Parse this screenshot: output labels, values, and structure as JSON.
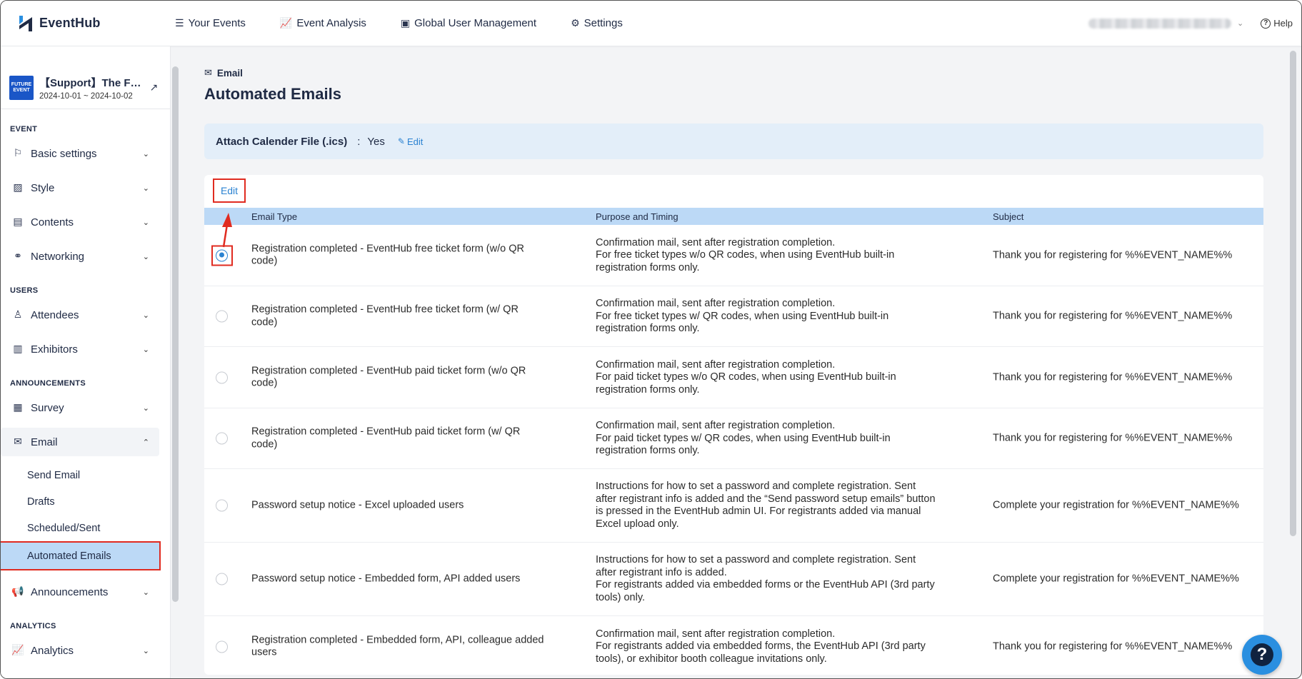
{
  "app": {
    "name": "EventHub"
  },
  "nav": {
    "items": [
      {
        "label": "Your Events",
        "icon": "list-icon"
      },
      {
        "label": "Event Analysis",
        "icon": "chart-icon"
      },
      {
        "label": "Global User Management",
        "icon": "id-card-icon"
      },
      {
        "label": "Settings",
        "icon": "gear-icon"
      }
    ],
    "help_label": "Help"
  },
  "event": {
    "thumb_text": "FUTURE EVENT",
    "name": "【Support】The F…",
    "dates": "2024-10-01 ~ 2024-10-02"
  },
  "sidebar": {
    "sections": {
      "event": "EVENT",
      "users": "USERS",
      "announcements": "ANNOUNCEMENTS",
      "analytics": "ANALYTICS"
    },
    "items": {
      "basic_settings": "Basic settings",
      "style": "Style",
      "contents": "Contents",
      "networking": "Networking",
      "attendees": "Attendees",
      "exhibitors": "Exhibitors",
      "survey": "Survey",
      "email": "Email",
      "announcements": "Announcements",
      "analytics": "Analytics"
    },
    "email_sub": {
      "send_email": "Send Email",
      "drafts": "Drafts",
      "scheduled_sent": "Scheduled/Sent",
      "automated_emails": "Automated Emails"
    }
  },
  "main": {
    "breadcrumb": "Email",
    "title": "Automated Emails",
    "ics": {
      "label": "Attach Calender File (.ics)",
      "sep": ":",
      "value": "Yes",
      "edit": "Edit"
    },
    "edit_button": "Edit",
    "table": {
      "headers": {
        "type": "Email Type",
        "purpose": "Purpose and Timing",
        "subject": "Subject"
      },
      "rows": [
        {
          "type1": "Registration completed - EventHub free ticket form (w/o QR",
          "type2": "code)",
          "p1": "Confirmation mail, sent after registration completion.",
          "p2": "For free ticket types w/o QR codes, when using EventHub built-in",
          "p3": "registration forms only.",
          "subject": "Thank you for registering for %%EVENT_NAME%%",
          "selected": true
        },
        {
          "type1": "Registration completed - EventHub free ticket form (w/ QR",
          "type2": "code)",
          "p1": "Confirmation mail, sent after registration completion.",
          "p2": "For free ticket types w/ QR codes, when using EventHub built-in",
          "p3": "registration forms only.",
          "subject": "Thank you for registering for %%EVENT_NAME%%",
          "selected": false
        },
        {
          "type1": "Registration completed - EventHub paid ticket form (w/o QR",
          "type2": "code)",
          "p1": "Confirmation mail, sent after registration completion.",
          "p2": "For paid ticket types w/o QR codes, when using EventHub built-in",
          "p3": "registration forms only.",
          "subject": "Thank you for registering for %%EVENT_NAME%%",
          "selected": false
        },
        {
          "type1": "Registration completed - EventHub paid ticket form (w/ QR",
          "type2": "code)",
          "p1": "Confirmation mail, sent after registration completion.",
          "p2": "For paid ticket types w/ QR codes, when using EventHub built-in",
          "p3": "registration forms only.",
          "subject": "Thank you for registering for %%EVENT_NAME%%",
          "selected": false
        },
        {
          "type1": "Password setup notice - Excel uploaded users",
          "type2": "",
          "p1": "Instructions for how to set a password and complete registration. Sent",
          "p2": "after registrant info is added and the “Send password setup emails” button",
          "p3": "is pressed in the EventHub admin UI. For registrants added via manual",
          "p4": "Excel upload only.",
          "subject": "Complete your registration for %%EVENT_NAME%%",
          "selected": false
        },
        {
          "type1": "Password setup notice - Embedded form, API added users",
          "type2": "",
          "p1": "Instructions for how to set a password and complete registration. Sent",
          "p2": "after registrant info is added.",
          "p3": "For registrants added via embedded forms or the EventHub API (3rd party",
          "p4": "tools) only.",
          "subject": "Complete your registration for %%EVENT_NAME%%",
          "selected": false
        },
        {
          "type1": "Registration completed - Embedded form, API, colleague added",
          "type2": "users",
          "p1": "Confirmation mail, sent after registration completion.",
          "p2": "For registrants added via embedded forms, the EventHub API (3rd party",
          "p3": "tools), or exhibitor booth colleague invitations only.",
          "subject": "Thank you for registering for %%EVENT_NAME%%",
          "selected": false
        }
      ]
    }
  },
  "colors": {
    "accent": "#2a82d1",
    "highlight": "#e02b20",
    "header_bg": "#bcd9f6",
    "ics_bg": "#e3eef9"
  }
}
